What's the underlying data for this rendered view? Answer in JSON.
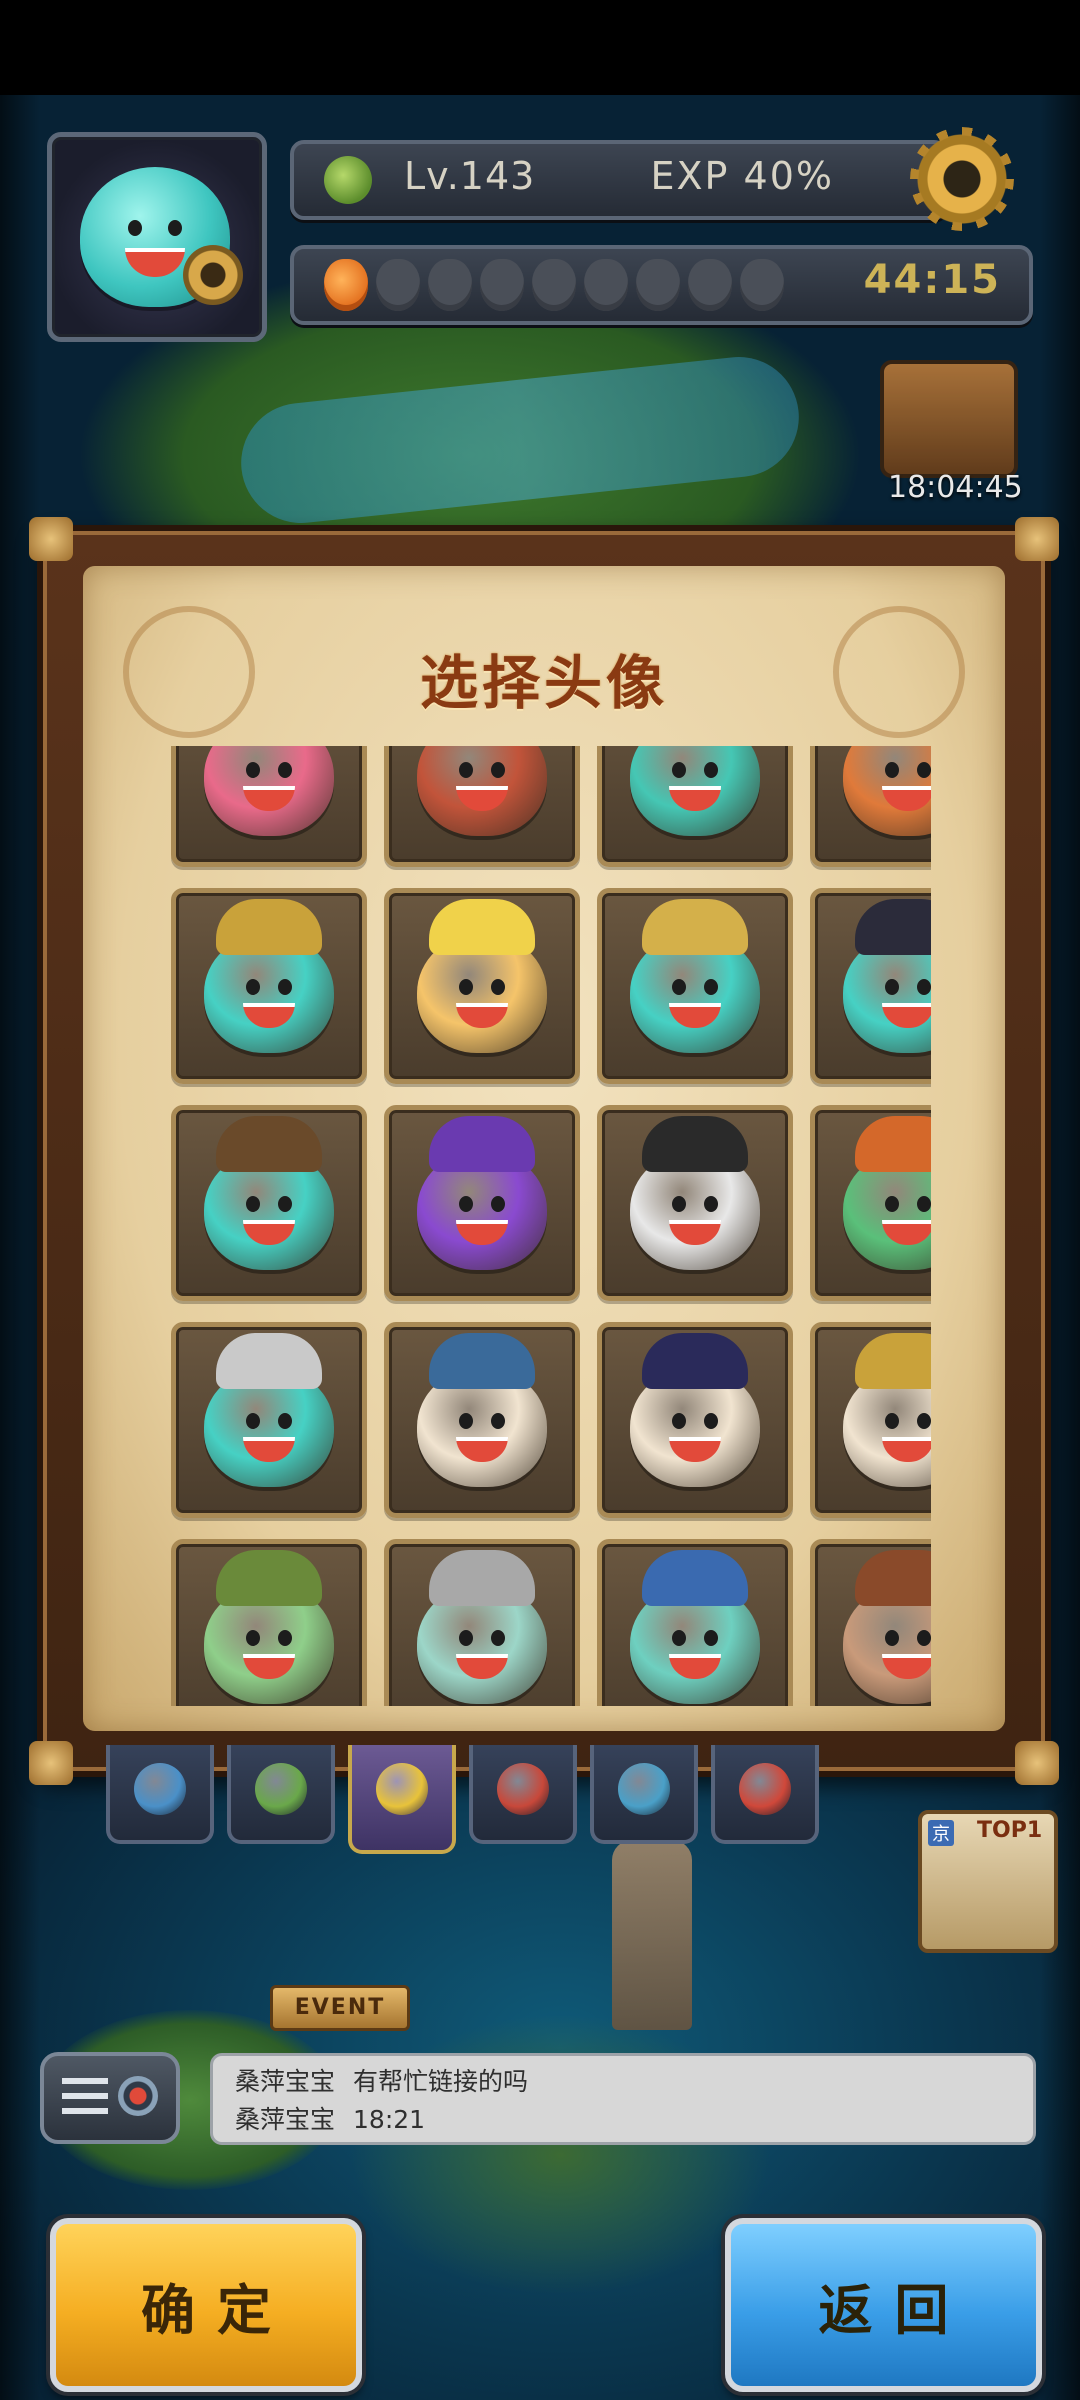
{
  "hud": {
    "level": "Lv.143",
    "exp": "EXP 40%",
    "stamina_full": 1,
    "stamina_total": 9,
    "timer": "44:15",
    "clock": "18:04:45"
  },
  "dialog": {
    "title": "选择头像"
  },
  "avatars": [
    {
      "color": "#e96a8a",
      "hat": "#b3242a"
    },
    {
      "color": "#c2543a",
      "hat": "#d67a2a"
    },
    {
      "color": "#45c7b4",
      "hat": "#3a3a3a"
    },
    {
      "color": "#e07a3a",
      "hat": "#c89a34"
    },
    {
      "color": "#46d1c4",
      "hat": "#c9a23a"
    },
    {
      "color": "#f5c46a",
      "hat": "#f0d24a"
    },
    {
      "color": "#46d1c4",
      "hat": "#d4b04a"
    },
    {
      "color": "#46d1c4",
      "hat": "#2b2b3a"
    },
    {
      "color": "#46d1c4",
      "hat": "#6a4a2a"
    },
    {
      "color": "#8a4ad0",
      "hat": "#6a3ab0"
    },
    {
      "color": "#e8e8e8",
      "hat": "#2a2a2a"
    },
    {
      "color": "#5ac07a",
      "hat": "#d4682a"
    },
    {
      "color": "#46d1c4",
      "hat": "#c9c9c9"
    },
    {
      "color": "#f1e4d0",
      "hat": "#3a6a9a"
    },
    {
      "color": "#f1e4d0",
      "hat": "#2a2a5a"
    },
    {
      "color": "#f1e4d0",
      "hat": "#c9a23a"
    },
    {
      "color": "#8fcf8a",
      "hat": "#6a8a3a"
    },
    {
      "color": "#9cd6c8",
      "hat": "#a8a8a8"
    },
    {
      "color": "#6ed0c0",
      "hat": "#3a6ab0"
    },
    {
      "color": "#c99a7a",
      "hat": "#8a4a2a"
    }
  ],
  "tabs": [
    {
      "name": "tab-blue",
      "color": "#4a90c8",
      "active": false
    },
    {
      "name": "tab-green",
      "color": "#6aa84a",
      "active": false
    },
    {
      "name": "tab-gold",
      "color": "#e8c33a",
      "active": true
    },
    {
      "name": "tab-red",
      "color": "#c8483a",
      "active": false
    },
    {
      "name": "tab-question",
      "color": "#4aa0c8",
      "active": false
    },
    {
      "name": "tab-beast",
      "color": "#d0483a",
      "active": false
    }
  ],
  "top_ribbon": {
    "badge": "京",
    "label": "TOP1"
  },
  "event_sign": "EVENT",
  "chat": {
    "line1_name": "桑萍宝宝",
    "line1_text": "有帮忙链接的吗",
    "line2_name": "桑萍宝宝",
    "line2_text": "18:21"
  },
  "buttons": {
    "confirm": "确定",
    "back": "返回"
  }
}
